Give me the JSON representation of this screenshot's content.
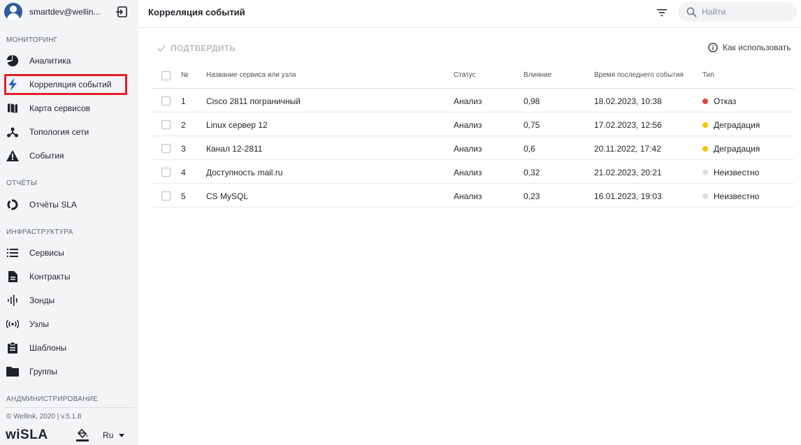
{
  "user": {
    "name": "smartdev@wellin..."
  },
  "sidebar": {
    "sections": [
      {
        "title": "МОНИТОРИНГ",
        "items": [
          {
            "label": "Аналитика",
            "icon": "pie-chart-icon"
          },
          {
            "label": "Корреляция событий",
            "icon": "lightning-icon",
            "active": true
          },
          {
            "label": "Карта сервисов",
            "icon": "map-icon"
          },
          {
            "label": "Топология сети",
            "icon": "topology-icon"
          },
          {
            "label": "События",
            "icon": "warning-icon"
          }
        ]
      },
      {
        "title": "ОТЧЁТЫ",
        "items": [
          {
            "label": "Отчёты SLA",
            "icon": "donut-icon"
          }
        ]
      },
      {
        "title": "ИНФРАСТРУКТУРА",
        "items": [
          {
            "label": "Сервисы",
            "icon": "list-icon"
          },
          {
            "label": "Контракты",
            "icon": "document-icon"
          },
          {
            "label": "Зонды",
            "icon": "probe-icon"
          },
          {
            "label": "Узлы",
            "icon": "radio-waves-icon"
          },
          {
            "label": "Шаблоны",
            "icon": "clipboard-icon"
          },
          {
            "label": "Группы",
            "icon": "folder-icon"
          }
        ]
      },
      {
        "title": "АНДМИНИСТРИРОВАНИЕ",
        "items": []
      }
    ],
    "copyright": "© Wellink, 2020 | v.5.1.8",
    "logo": "wiSLA",
    "language": "Ru"
  },
  "header": {
    "title": "Корреляция событий",
    "search_placeholder": "Найти"
  },
  "toolbar": {
    "confirm_label": "ПОДТВЕРДИТЬ",
    "howto_label": "Как использовать"
  },
  "table": {
    "columns": {
      "num": "№",
      "name": "Название сервиса или узла",
      "status": "Статус",
      "impact": "Влияние",
      "last_event": "Время последнего события",
      "type": "Тип"
    },
    "rows": [
      {
        "num": "1",
        "name": "Cisco 2811 пограничный",
        "status": "Анализ",
        "impact": "0,98",
        "last_event": "18.02.2023, 10:38",
        "type": "Отказ",
        "type_color": "#e0483e"
      },
      {
        "num": "2",
        "name": "Linux сервер 12",
        "status": "Анализ",
        "impact": "0,75",
        "last_event": "17.02.2023, 12:56",
        "type": "Деградация",
        "type_color": "#f5c400"
      },
      {
        "num": "3",
        "name": "Канал 12-2811",
        "status": "Анализ",
        "impact": "0,6",
        "last_event": "20.11.2022, 17:42",
        "type": "Деградация",
        "type_color": "#f5c400"
      },
      {
        "num": "4",
        "name": "Доступность mail.ru",
        "status": "Анализ",
        "impact": "0,32",
        "last_event": "21.02.2023, 20:21",
        "type": "Неизвестно",
        "type_color": "#dcdde0"
      },
      {
        "num": "5",
        "name": "CS MySQL",
        "status": "Анализ",
        "impact": "0,23",
        "last_event": "16.01.2023, 19:03",
        "type": "Неизвестно",
        "type_color": "#dcdde0"
      }
    ]
  }
}
